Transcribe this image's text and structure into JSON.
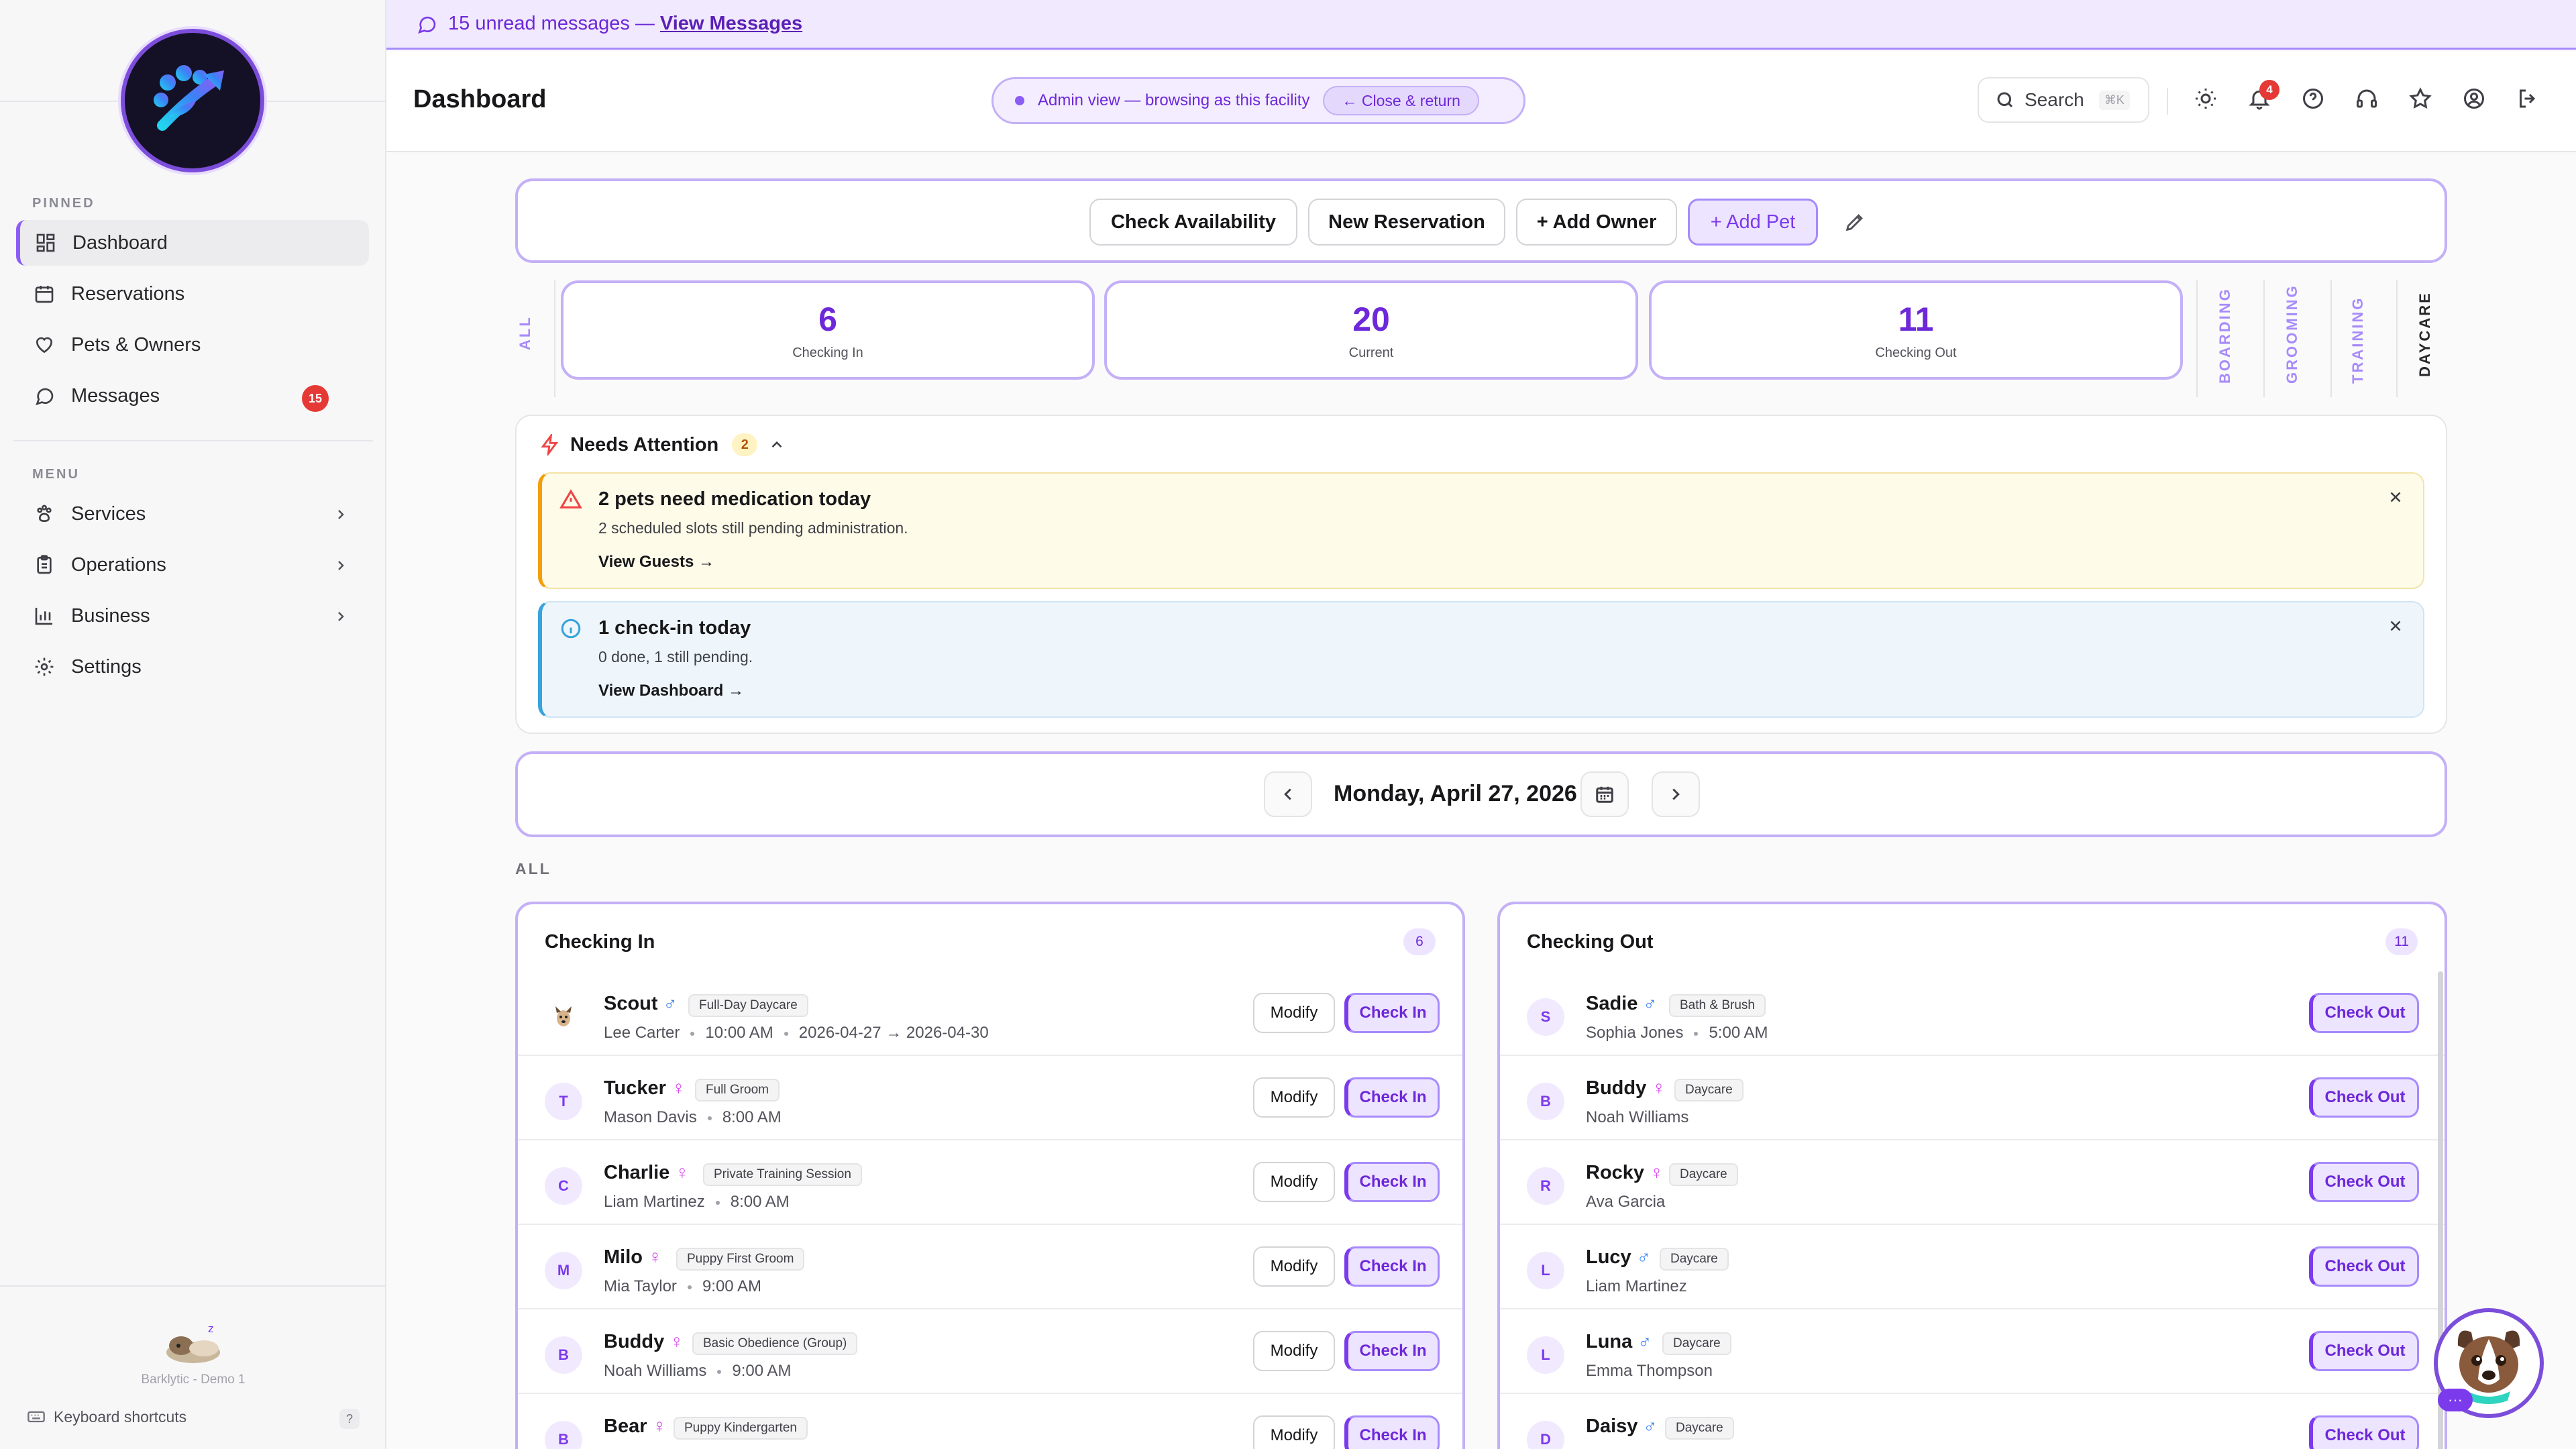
{
  "sidebar": {
    "pinned_label": "PINNED",
    "menu_label": "MENU",
    "pinned": [
      {
        "label": "Dashboard",
        "icon": "dashboard-icon"
      },
      {
        "label": "Reservations",
        "icon": "calendar-icon"
      },
      {
        "label": "Pets & Owners",
        "icon": "heart-icon"
      },
      {
        "label": "Messages",
        "icon": "message-icon",
        "badge": "15"
      }
    ],
    "menu": [
      {
        "label": "Services",
        "icon": "paw-icon"
      },
      {
        "label": "Operations",
        "icon": "clipboard-icon"
      },
      {
        "label": "Business",
        "icon": "chart-icon"
      },
      {
        "label": "Settings",
        "icon": "gear-icon"
      }
    ],
    "footer_name": "Barklytic - Demo 1",
    "keyboard_shortcuts": "Keyboard shortcuts",
    "help_key": "?"
  },
  "banner": {
    "text": "15 unread messages —",
    "link": "View Messages"
  },
  "header": {
    "title": "Dashboard",
    "admin_text": "Admin view — browsing as this facility",
    "close_label": "← Close & return",
    "search_label": "Search",
    "search_kbd": "⌘K",
    "bell_badge": "4"
  },
  "actions": {
    "check_availability": "Check Availability",
    "new_reservation": "New Reservation",
    "add_owner": "+ Add Owner",
    "add_pet": "+ Add Pet"
  },
  "stats": {
    "all_label": "ALL",
    "checking_in": {
      "value": "6",
      "label": "Checking In"
    },
    "current": {
      "value": "20",
      "label": "Current"
    },
    "checking_out": {
      "value": "11",
      "label": "Checking Out"
    },
    "tabs": [
      "BOARDING",
      "GROOMING",
      "TRAINING",
      "DAYCARE"
    ]
  },
  "attention": {
    "title": "Needs Attention",
    "count": "2",
    "alerts": [
      {
        "title": "2 pets need medication today",
        "sub": "2 scheduled slots still pending administration.",
        "link": "View Guests →"
      },
      {
        "title": "1 check-in today",
        "sub": "0 done, 1 still pending.",
        "link": "View Dashboard →"
      }
    ]
  },
  "date": {
    "label": "Monday, April 27, 2026"
  },
  "section_label": "ALL",
  "checking_in": {
    "title": "Checking In",
    "count": "6",
    "modify_label": "Modify",
    "action_label": "Check In",
    "rows": [
      {
        "initial": "",
        "name": "Scout",
        "gender": "♂",
        "g": "m",
        "service": "Full-Day Daycare",
        "owner": "Lee Carter",
        "time": "10:00 AM",
        "range": "2026-04-27 → 2026-04-30"
      },
      {
        "initial": "T",
        "name": "Tucker",
        "gender": "♀",
        "g": "f",
        "service": "Full Groom",
        "owner": "Mason Davis",
        "time": "8:00 AM",
        "range": ""
      },
      {
        "initial": "C",
        "name": "Charlie",
        "gender": "♀",
        "g": "f",
        "service": "Private Training Session",
        "owner": "Liam Martinez",
        "time": "8:00 AM",
        "range": ""
      },
      {
        "initial": "M",
        "name": "Milo",
        "gender": "♀",
        "g": "f",
        "service": "Puppy First Groom",
        "owner": "Mia Taylor",
        "time": "9:00 AM",
        "range": ""
      },
      {
        "initial": "B",
        "name": "Buddy",
        "gender": "♀",
        "g": "f",
        "service": "Basic Obedience (Group)",
        "owner": "Noah Williams",
        "time": "9:00 AM",
        "range": ""
      },
      {
        "initial": "B",
        "name": "Bear",
        "gender": "♀",
        "g": "f",
        "service": "Puppy Kindergarten",
        "owner": "",
        "time": "",
        "range": ""
      }
    ]
  },
  "checking_out": {
    "title": "Checking Out",
    "count": "11",
    "action_label": "Check Out",
    "rows": [
      {
        "initial": "S",
        "name": "Sadie",
        "gender": "♂",
        "g": "m",
        "service": "Bath & Brush",
        "owner": "Sophia Jones",
        "time": "5:00 AM"
      },
      {
        "initial": "B",
        "name": "Buddy",
        "gender": "♀",
        "g": "f",
        "service": "Daycare",
        "owner": "Noah Williams",
        "time": ""
      },
      {
        "initial": "R",
        "name": "Rocky",
        "gender": "♀",
        "g": "f",
        "service": "Daycare",
        "owner": "Ava Garcia",
        "time": ""
      },
      {
        "initial": "L",
        "name": "Lucy",
        "gender": "♂",
        "g": "m",
        "service": "Daycare",
        "owner": "Liam Martinez",
        "time": ""
      },
      {
        "initial": "L",
        "name": "Luna",
        "gender": "♂",
        "g": "m",
        "service": "Daycare",
        "owner": "Emma Thompson",
        "time": ""
      },
      {
        "initial": "D",
        "name": "Daisy",
        "gender": "♂",
        "g": "m",
        "service": "Daycare",
        "owner": "",
        "time": ""
      }
    ]
  },
  "colors": {
    "accent": "#7c3aed",
    "accent_light": "#ede4ff",
    "warn": "#f59e0b",
    "info": "#38a3dc",
    "badge": "#e53935"
  }
}
